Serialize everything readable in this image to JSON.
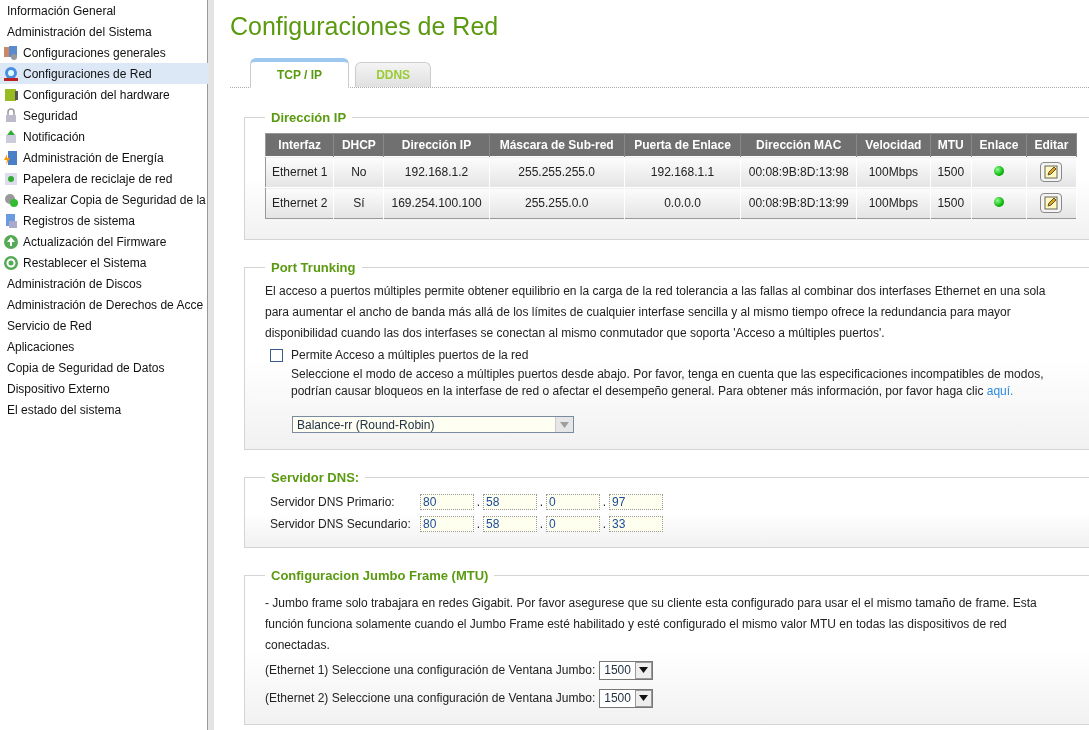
{
  "sidebar": {
    "items": [
      {
        "label": "Información General",
        "selected": false
      },
      {
        "label": "Administración del Sistema",
        "selected": false,
        "children": [
          {
            "label": "Configuraciones generales",
            "selected": false
          },
          {
            "label": "Configuraciones de Red",
            "selected": true
          },
          {
            "label": "Configuración del hardware",
            "selected": false
          },
          {
            "label": "Seguridad",
            "selected": false
          },
          {
            "label": "Notificación",
            "selected": false
          },
          {
            "label": "Administración de Energía",
            "selected": false
          },
          {
            "label": "Papelera de reciclaje de red",
            "selected": false
          },
          {
            "label": "Realizar Copia de Seguridad de la",
            "selected": false
          },
          {
            "label": "Registros de sistema",
            "selected": false
          },
          {
            "label": "Actualización del Firmware",
            "selected": false
          },
          {
            "label": "Restablecer el Sistema",
            "selected": false
          }
        ]
      },
      {
        "label": "Administración de Discos",
        "selected": false
      },
      {
        "label": "Administración de Derechos de Acce",
        "selected": false
      },
      {
        "label": "Servicio de Red",
        "selected": false
      },
      {
        "label": "Aplicaciones",
        "selected": false
      },
      {
        "label": "Copia de Seguridad de Datos",
        "selected": false
      },
      {
        "label": "Dispositivo Externo",
        "selected": false
      },
      {
        "label": "El estado del sistema",
        "selected": false
      }
    ]
  },
  "page_title": "Configuraciones de Red",
  "tabs": [
    {
      "label": "TCP / IP",
      "selected": true
    },
    {
      "label": "DDNS",
      "selected": false
    }
  ],
  "ip_section": {
    "title": "Dirección IP",
    "columns": [
      "Interfaz",
      "DHCP",
      "Dirección IP",
      "Máscara de Sub-red",
      "Puerta de Enlace",
      "Dirección MAC",
      "Velocidad",
      "MTU",
      "Enlace",
      "Editar"
    ],
    "rows": [
      {
        "cells": [
          "Ethernet 1",
          "No",
          "192.168.1.2",
          "255.255.255.0",
          "192.168.1.1",
          "00:08:9B:8D:13:98",
          "100Mbps",
          "1500"
        ],
        "link_up": true
      },
      {
        "cells": [
          "Ethernet 2",
          "Sí",
          "169.254.100.100",
          "255.255.0.0",
          "0.0.0.0",
          "00:08:9B:8D:13:99",
          "100Mbps",
          "1500"
        ],
        "link_up": true
      }
    ]
  },
  "port_trunking": {
    "title": "Port Trunking",
    "description": "El acceso a puertos múltiples permite obtener equilibrio en la carga de la red tolerancia a las fallas al combinar dos interfases Ethernet en una sola para aumentar el ancho de banda más allá de los límites de cualquier interfase sencilla y al mismo tiempo ofrece la redundancia para mayor disponibilidad cuando las dos interfases se conectan al mismo conmutador que soporta 'Acceso a múltiples puertos'.",
    "checkbox": {
      "label": "Permite Acceso a múltiples puertos de la red",
      "checked": false
    },
    "hint": "Seleccione el modo de acceso a múltiples puertos desde abajo. Por favor, tenga en cuenta que las especificaciones incompatibles de modos, podrían causar bloqueos en la interfase de red o afectar el desempeño general. Para obtener más información, por favor haga clic",
    "hint_link": "aquí.",
    "mode_select": {
      "value": "Balance-rr (Round-Robin)",
      "disabled": true
    }
  },
  "dns": {
    "title": "Servidor DNS:",
    "rows": [
      {
        "label": "Servidor DNS Primario:",
        "octets": [
          "80",
          "58",
          "0",
          "97"
        ],
        "separators": [
          ".",
          ".",
          "."
        ]
      },
      {
        "label": "Servidor DNS Secundario:",
        "octets": [
          "80",
          "58",
          "0",
          "33"
        ],
        "separators": [
          ".",
          ".",
          "."
        ]
      }
    ]
  },
  "jumbo": {
    "title": "Configuracion Jumbo Frame (MTU)",
    "description": "- Jumbo frame solo trabajara en redes Gigabit. Por favor asegurese que su cliente esta configurado para usar el el mismo tamaño de frame. Esta función funciona solamente cuando el Jumbo Frame esté habilitado y esté configurado el mismo valor MTU en todas las dispositivos de red conectadas.",
    "rows": [
      {
        "label": "(Ethernet 1) Seleccione una configuración de Ventana Jumbo:",
        "value": "1500"
      },
      {
        "label": "(Ethernet 2) Seleccione una configuración de Ventana Jumbo:",
        "value": "1500"
      }
    ]
  }
}
